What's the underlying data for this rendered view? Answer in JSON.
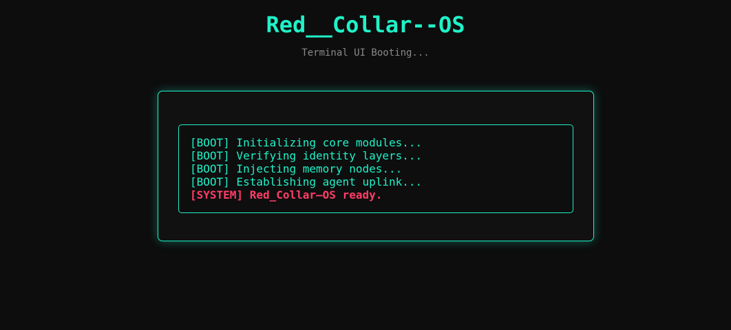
{
  "header": {
    "title": "Red__Collar--OS",
    "subtitle": "Terminal UI Booting..."
  },
  "terminal": {
    "lines": [
      {
        "text": "[BOOT] Initializing core modules...",
        "kind": "boot"
      },
      {
        "text": "[BOOT] Verifying identity layers...",
        "kind": "boot"
      },
      {
        "text": "[BOOT] Injecting memory nodes...",
        "kind": "boot"
      },
      {
        "text": "[BOOT] Establishing agent uplink...",
        "kind": "boot"
      },
      {
        "text": "[SYSTEM] Red_Collar—OS ready.",
        "kind": "system"
      }
    ]
  },
  "colors": {
    "background": "#0d0d0d",
    "accent": "#1ff2c8",
    "system": "#ff3d68",
    "subtitle": "#8a8a8a"
  }
}
